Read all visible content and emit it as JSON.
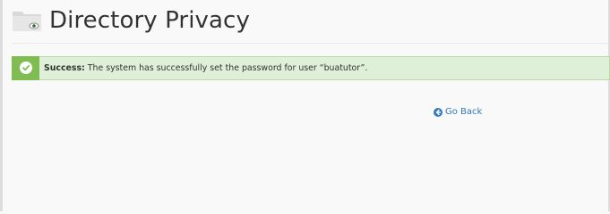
{
  "header": {
    "title": "Directory Privacy",
    "icon": "folder-eye-icon"
  },
  "alert": {
    "type": "success",
    "icon": "check-circle-icon",
    "label": "Success:",
    "message": " The system has successfully set the password for user “buatutor”.",
    "colors": {
      "background": "#dff0d8",
      "icon_background": "#7fbd52"
    }
  },
  "go_back": {
    "label": "Go Back",
    "icon": "arrow-left-circle-icon",
    "color": "#337ab7"
  }
}
